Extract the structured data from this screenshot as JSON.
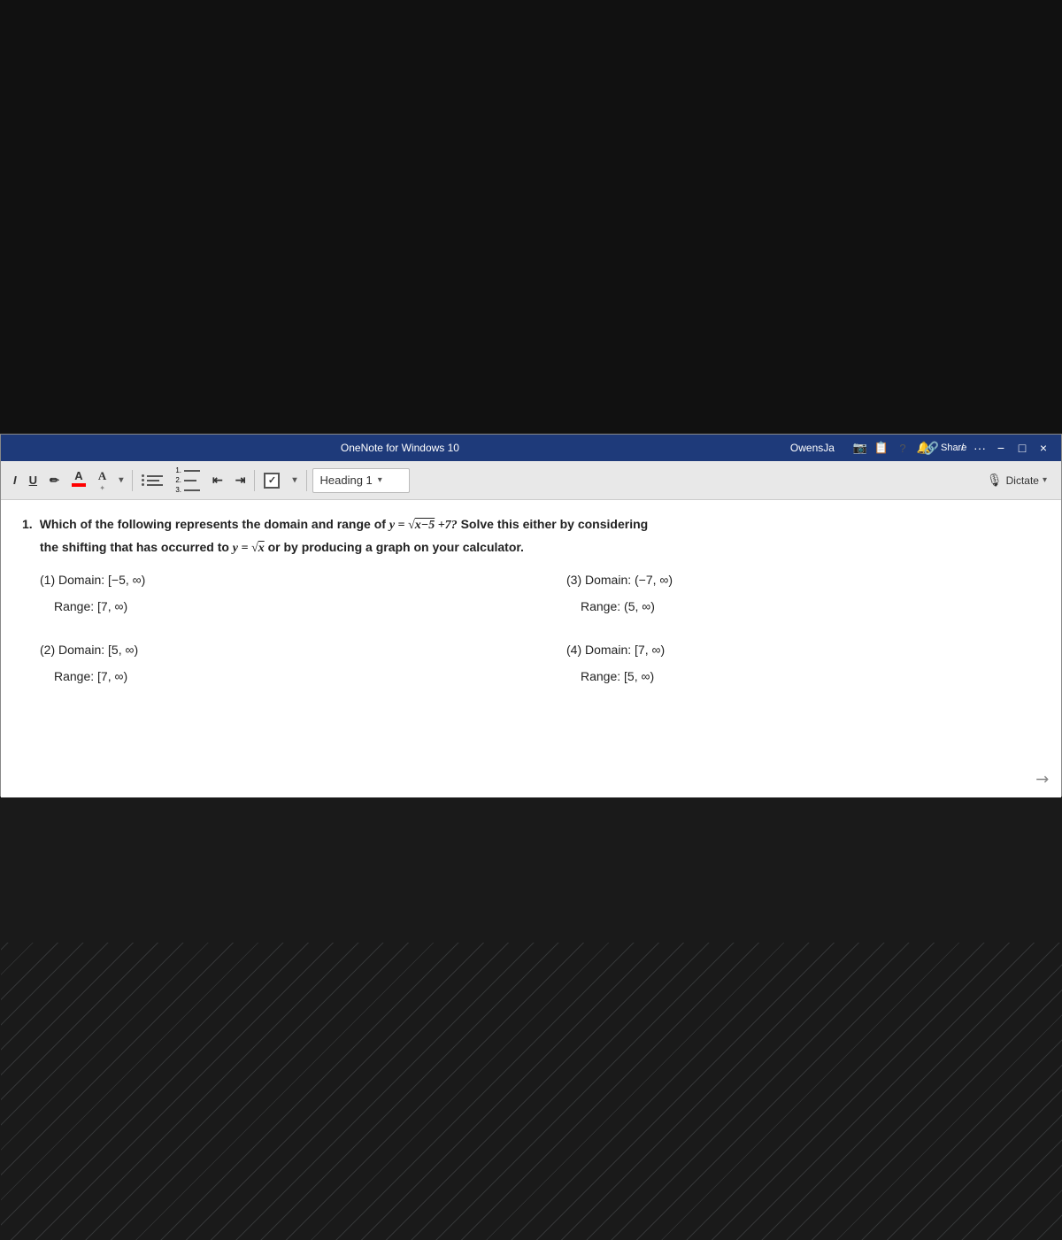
{
  "window": {
    "title": "OneNote for Windows 10",
    "user": "OwensJa",
    "minimize_label": "−",
    "restore_label": "□",
    "close_label": "×"
  },
  "toolbar": {
    "italic_label": "I",
    "underline_label": "U",
    "strikethrough_label": "∂",
    "font_color_letter": "A",
    "font_style_letter": "A",
    "list_label": "≡",
    "numbered_list_label": "≡",
    "indent_decrease": "⇤",
    "indent_increase": "⇥",
    "checkbox_label": "✓",
    "heading_label": "Heading 1",
    "dictate_label": "Dictate",
    "share_label": "Share",
    "more_label": "···",
    "quick_icon1": "🔔",
    "quick_icon2": "?",
    "quick_icon3": "📋",
    "quick_icon4": "🔔"
  },
  "content": {
    "question_number": "1.",
    "question_main": "Which of the following represents the domain and range of",
    "equation_main": "y = √x−5 +7?",
    "question_suffix": "Solve this either by considering",
    "question_line2_start": "the shifting that has occurred to",
    "equation_ref": "y = √x",
    "question_line2_end": "or by producing a graph on your calculator.",
    "answers": [
      {
        "id": "ans1",
        "label": "(1) Domain: [−5, ∞)",
        "range_label": "(3) Domain: (−7, ∞)"
      },
      {
        "id": "ans1r",
        "label": "Range: [7, ∞)",
        "range_label": "Range: (5, ∞)"
      },
      {
        "id": "ans2",
        "label": "(2) Domain: [5, ∞)",
        "range_label": "(4) Domain: [7, ∞)"
      },
      {
        "id": "ans2r",
        "label": "Range: [7, ∞)",
        "range_label": "Range: [5, ∞)"
      }
    ]
  }
}
